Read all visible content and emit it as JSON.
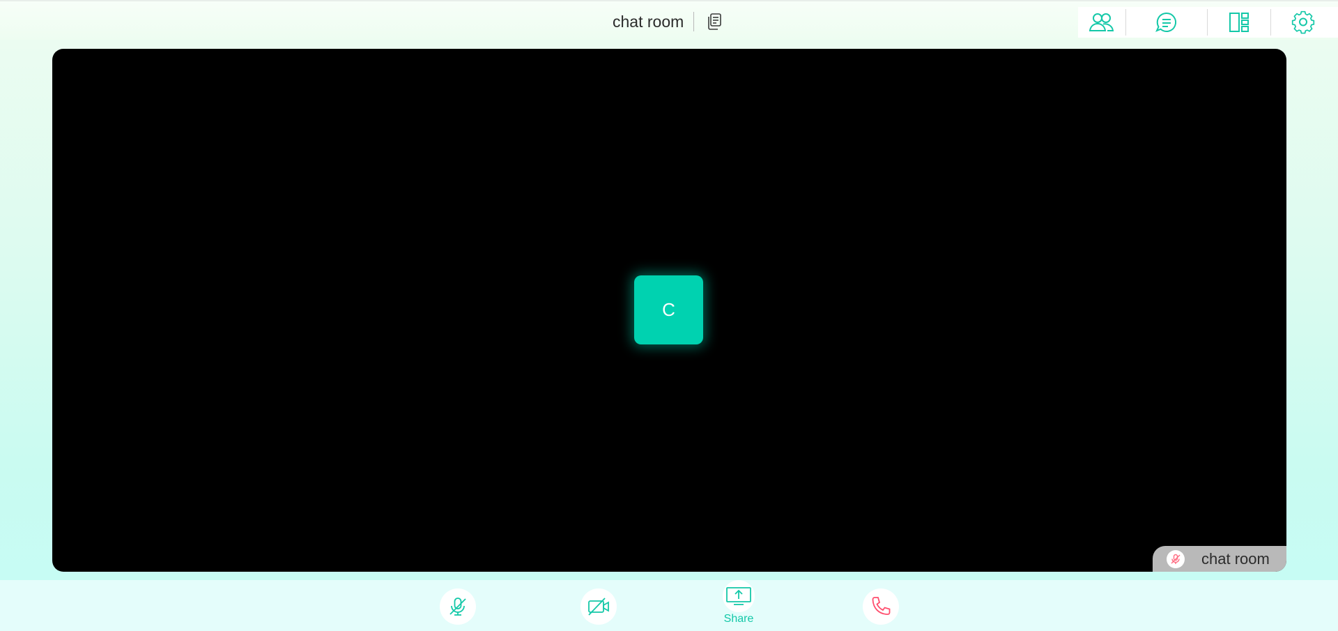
{
  "header": {
    "room_title": "chat room",
    "copy_icon": "copy-icon",
    "actions": [
      {
        "icon": "participants-icon"
      },
      {
        "icon": "chat-icon"
      },
      {
        "icon": "layout-icon"
      },
      {
        "icon": "settings-icon"
      }
    ]
  },
  "stage": {
    "avatar_initial": "C",
    "name_tag": {
      "label": "chat room",
      "mic_icon": "mic-muted-icon"
    }
  },
  "controls": {
    "mic_icon": "mic-muted-icon",
    "camera_icon": "camera-off-icon",
    "share_icon": "share-screen-icon",
    "share_label": "Share",
    "hangup_icon": "hang-up-icon"
  },
  "colors": {
    "accent": "#14c8a8",
    "avatar": "#00d2b0",
    "hangup": "#ff4d6d",
    "stage_background": "#000000"
  }
}
